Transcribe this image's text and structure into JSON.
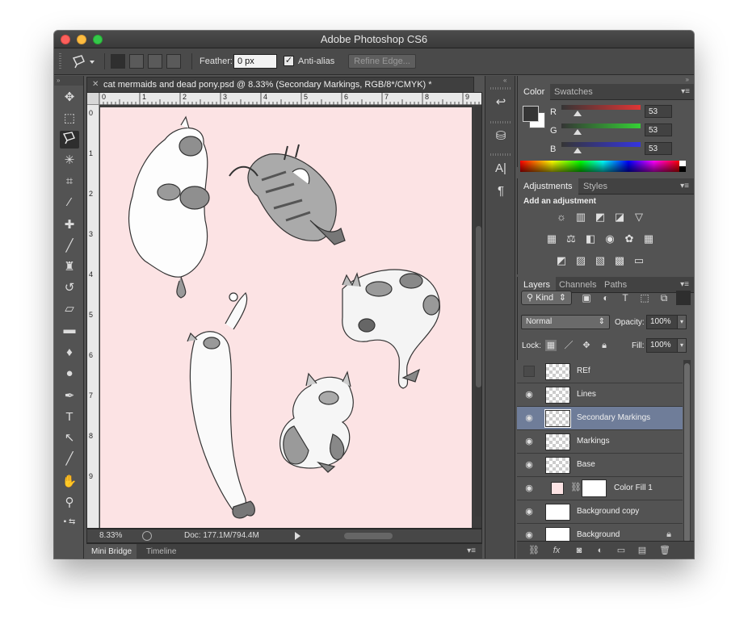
{
  "app": {
    "title": "Adobe Photoshop CS6"
  },
  "options": {
    "feather_label": "Feather:",
    "feather_value": "0 px",
    "antialias_label": "Anti-alias",
    "antialias_checked": true,
    "refine_edge_label": "Refine Edge..."
  },
  "tools": [
    {
      "name": "move-tool",
      "glyph": "▶✥"
    },
    {
      "name": "marquee-tool",
      "glyph": "⬚"
    },
    {
      "name": "lasso-tool",
      "glyph": "ᐯ"
    },
    {
      "name": "magic-wand-tool",
      "glyph": "✳"
    },
    {
      "name": "crop-tool",
      "glyph": "⌗"
    },
    {
      "name": "eyedropper-tool",
      "glyph": "⁄"
    },
    {
      "name": "healing-brush-tool",
      "glyph": "✚"
    },
    {
      "name": "brush-tool",
      "glyph": "／"
    },
    {
      "name": "clone-stamp-tool",
      "glyph": "♜"
    },
    {
      "name": "history-brush-tool",
      "glyph": "↺"
    },
    {
      "name": "eraser-tool",
      "glyph": "▱"
    },
    {
      "name": "gradient-tool",
      "glyph": "▬"
    },
    {
      "name": "blur-tool",
      "glyph": "💧"
    },
    {
      "name": "dodge-tool",
      "glyph": "●"
    },
    {
      "name": "pen-tool",
      "glyph": "✒"
    },
    {
      "name": "type-tool",
      "glyph": "T"
    },
    {
      "name": "path-selection-tool",
      "glyph": "↖"
    },
    {
      "name": "line-tool",
      "glyph": "╱"
    },
    {
      "name": "hand-tool",
      "glyph": "✋"
    },
    {
      "name": "zoom-tool",
      "glyph": "⚲"
    }
  ],
  "document": {
    "tab_title": "cat mermaids and dead pony.psd @ 8.33% (Secondary Markings, RGB/8*/CMYK) *",
    "ruler_h": [
      "0",
      "1",
      "2",
      "3",
      "4",
      "5",
      "6",
      "7",
      "8",
      "9"
    ],
    "ruler_v": [
      "0",
      "1",
      "2",
      "3",
      "4",
      "5",
      "6",
      "7",
      "8",
      "9"
    ],
    "canvas_color": "#fce3e4",
    "zoom": "8.33%",
    "doc_size": "Doc: 177.1M/794.4M"
  },
  "bottom_tabs": [
    "Mini Bridge",
    "Timeline"
  ],
  "color_panel": {
    "tabs": [
      "Color",
      "Swatches"
    ],
    "sliders": [
      {
        "label": "R",
        "value": "53"
      },
      {
        "label": "G",
        "value": "53"
      },
      {
        "label": "B",
        "value": "53"
      }
    ]
  },
  "adjustments_panel": {
    "tabs": [
      "Adjustments",
      "Styles"
    ],
    "title": "Add an adjustment"
  },
  "layers_panel": {
    "tabs": [
      "Layers",
      "Channels",
      "Paths"
    ],
    "kind_label": "Kind",
    "blend_mode": "Normal",
    "opacity_label": "Opacity:",
    "opacity_value": "100%",
    "lock_label": "Lock:",
    "fill_label": "Fill:",
    "fill_value": "100%",
    "layers": [
      {
        "name": "REf",
        "visible": false,
        "selected": false
      },
      {
        "name": "Lines",
        "visible": true,
        "selected": false
      },
      {
        "name": "Secondary Markings",
        "visible": true,
        "selected": true
      },
      {
        "name": "Markings",
        "visible": true,
        "selected": false
      },
      {
        "name": "Base",
        "visible": true,
        "selected": false
      },
      {
        "name": "Color Fill 1",
        "visible": true,
        "selected": false
      },
      {
        "name": "Background copy",
        "visible": true,
        "selected": false
      },
      {
        "name": "Background",
        "visible": true,
        "selected": false,
        "locked": true
      }
    ]
  }
}
